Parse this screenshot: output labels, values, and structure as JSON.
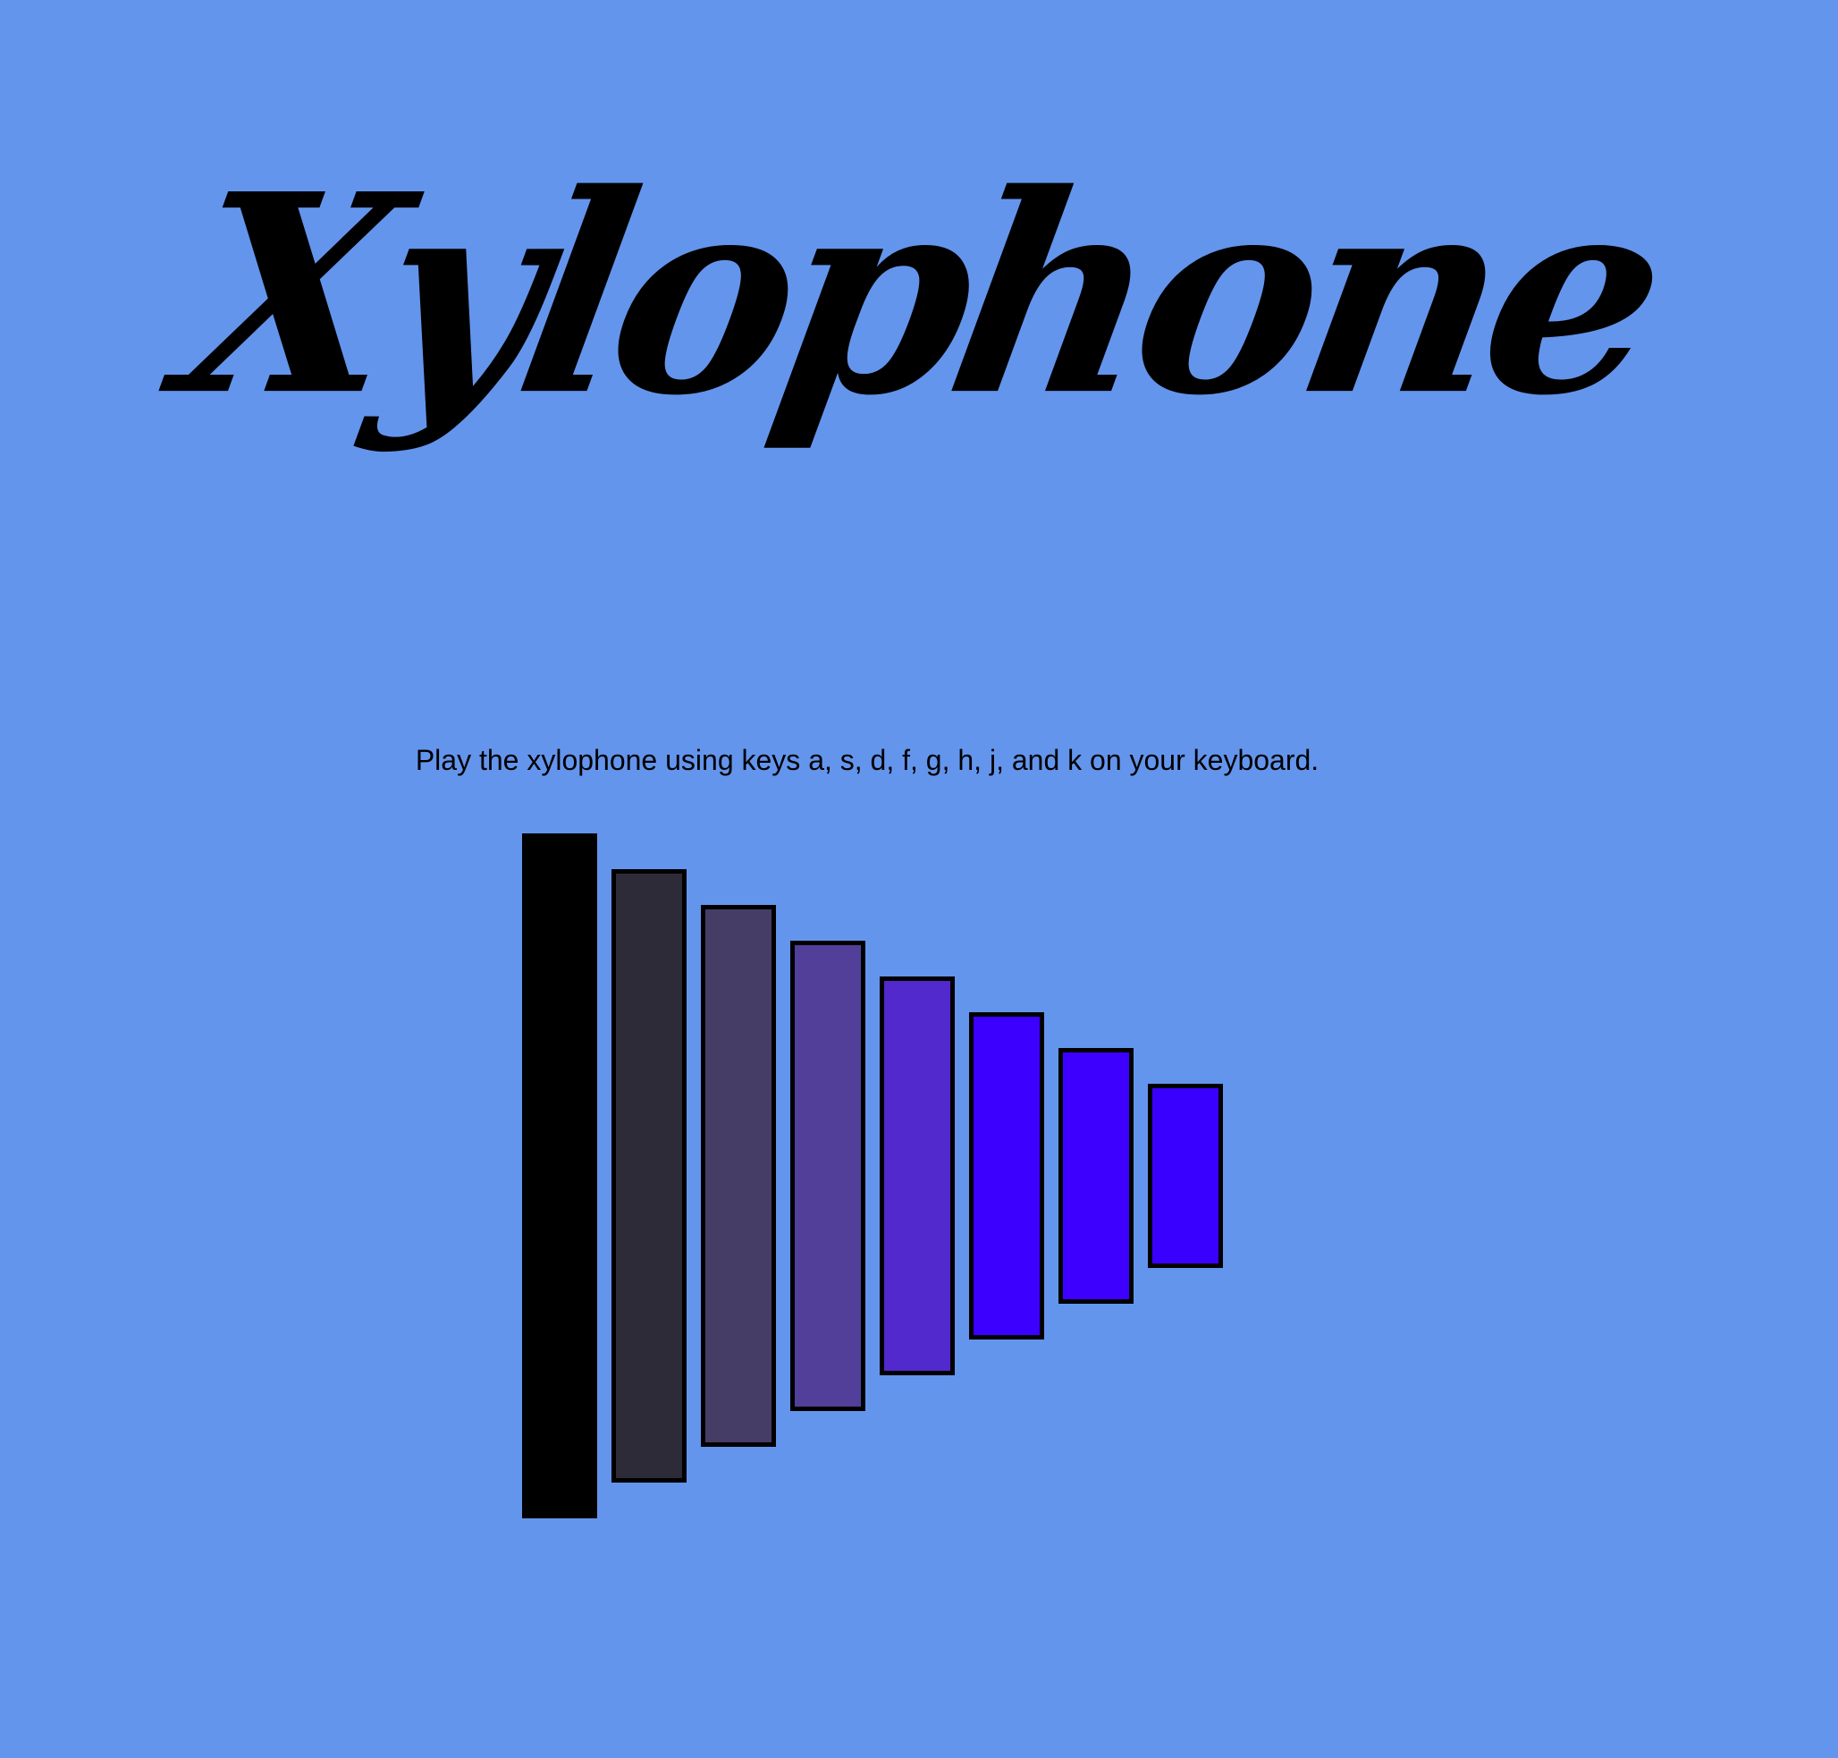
{
  "page": {
    "title": "Xylophone",
    "instructions": "Play the xylophone using keys a, s, d, f, g, h, j, and k on your keyboard."
  },
  "colors": {
    "background": "#6495ed"
  },
  "keys": [
    {
      "key": "a",
      "color": "#000000"
    },
    {
      "key": "s",
      "color": "#2e2b39"
    },
    {
      "key": "d",
      "color": "#463d67"
    },
    {
      "key": "f",
      "color": "#523f9a"
    },
    {
      "key": "g",
      "color": "#5229cc"
    },
    {
      "key": "h",
      "color": "#3c00ff"
    },
    {
      "key": "j",
      "color": "#3d00ff"
    },
    {
      "key": "k",
      "color": "#3a00ff"
    }
  ]
}
